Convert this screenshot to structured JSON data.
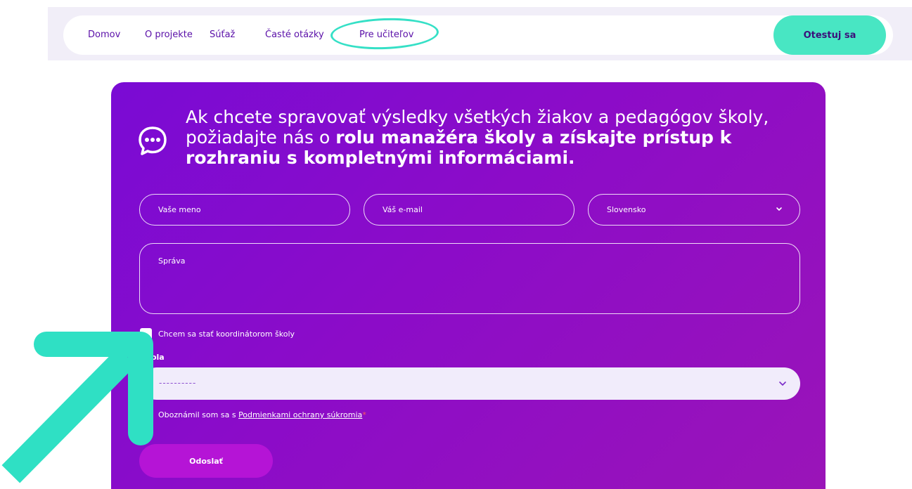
{
  "nav": {
    "links": [
      "Domov",
      "O projekte",
      "Súťaž",
      "Časté otázky",
      "Pre učiteľov"
    ],
    "cta_label": "Otestuj sa"
  },
  "intro": {
    "text_regular": "Ak chcete spravovať výsledky všetkých žiakov a pedagógov školy, požiadajte nás o ",
    "text_bold": "rolu manažéra školy a získajte prístup k rozhraniu s kompletnými informáciami."
  },
  "form": {
    "name_placeholder": "Vaše meno",
    "email_placeholder": "Váš e-mail",
    "country_value": "Slovensko",
    "message_placeholder": "Správa",
    "coordinator_label": "Chcem sa stať koordinátorom školy",
    "school_label": "Škola",
    "school_value": "----------",
    "privacy_prefix": "Oboznámil som sa s ",
    "privacy_link": "Podmienkami ochrany súkromia",
    "privacy_required": "*",
    "submit_label": "Odoslať"
  },
  "colors": {
    "brand_purple": "#7a0bd4",
    "accent_teal": "#48e6c3",
    "nav_text": "#5a0fa8"
  },
  "icons": {
    "chat": "chat-bubble-icon",
    "chevron": "chevron-down-icon",
    "annotation_arrow": "arrow-annotation"
  }
}
